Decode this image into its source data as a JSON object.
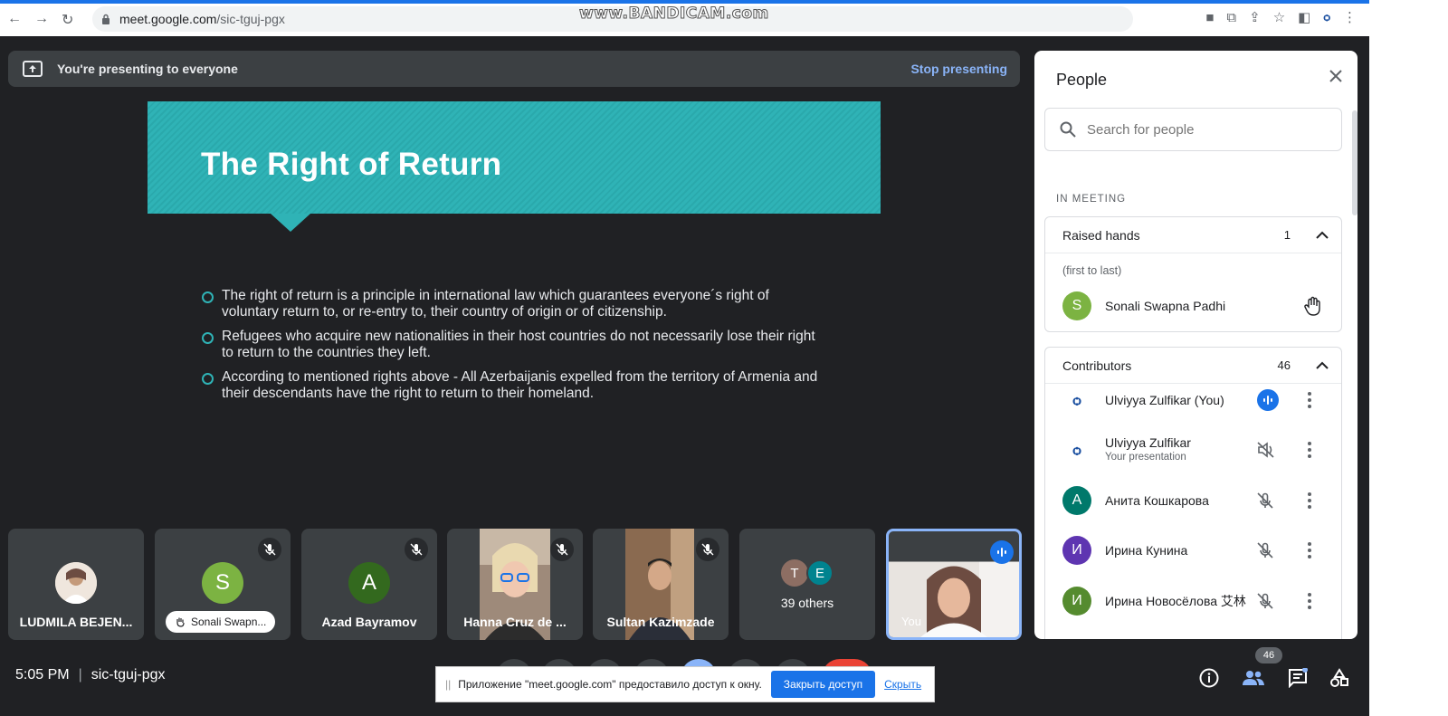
{
  "browser": {
    "url_host": "meet.google.com",
    "url_path": "/sic-tguj-pgx",
    "watermark": "www.BANDICAM.com"
  },
  "presenting": {
    "label": "You're presenting to everyone",
    "stop": "Stop presenting"
  },
  "slide": {
    "title": "The Right of Return",
    "bullets": [
      "The right of return is a principle in international law which guarantees everyone´s right of voluntary return to, or re-entry to, their country of origin or of citizenship.",
      "Refugees who acquire new nationalities in their host countries do not necessarily lose their right to return to the countries they left.",
      "According to mentioned rights above - All Azerbaijanis expelled from the territory of Armenia and their descendants have the right to return to their homeland."
    ]
  },
  "tiles": [
    {
      "name": "LUDMILA BEJEN..."
    },
    {
      "name": "Sonali Swapn...",
      "initial": "S",
      "color": "#7cb342"
    },
    {
      "name": "Azad Bayramov",
      "initial": "A",
      "color": "#33691e"
    },
    {
      "name": "Hanna Cruz de ..."
    },
    {
      "name": "Sultan Kazimzade"
    },
    {
      "name": "39 others",
      "initials": [
        "T",
        "E"
      ],
      "colors": [
        "#8d6e63",
        "#00838f"
      ]
    },
    {
      "name": "You"
    }
  ],
  "people": {
    "title": "People",
    "search_placeholder": "Search for people",
    "in_meeting": "IN MEETING",
    "raised": {
      "label": "Raised hands",
      "count": "1",
      "order": "(first to last)",
      "name": "Sonali Swapna Padhi",
      "initial": "S",
      "color": "#7cb342"
    },
    "contributors": {
      "label": "Contributors",
      "count": "46",
      "items": [
        {
          "name": "Ulviyya Zulfikar (You)",
          "sub": ""
        },
        {
          "name": "Ulviyya Zulfikar",
          "sub": "Your presentation"
        },
        {
          "name": "Анита Кошкарова",
          "initial": "А",
          "color": "#00796b"
        },
        {
          "name": "Ирина Кунина",
          "initial": "И",
          "color": "#5e35b1"
        },
        {
          "name": "Ирина Новосёлова 艾林",
          "initial": "И",
          "color": "#558b2f"
        }
      ]
    }
  },
  "footer": {
    "time": "5:05 PM",
    "sep": "|",
    "code": "sic-tguj-pgx",
    "people_badge": "46"
  },
  "share_notice": {
    "text": "Приложение \"meet.google.com\" предоставило доступ к окну.",
    "stop": "Закрыть доступ",
    "hide": "Скрыть",
    "grip": "||"
  }
}
